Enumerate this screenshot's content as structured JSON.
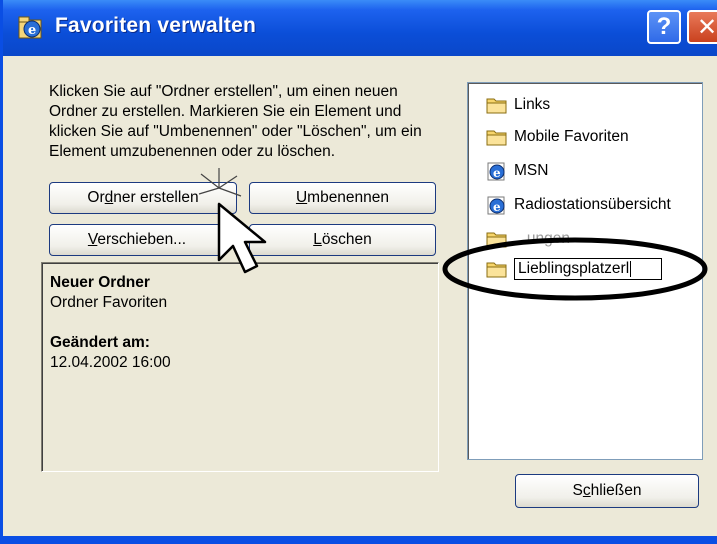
{
  "window": {
    "title": "Favoriten verwalten",
    "help_label": "?",
    "close_label": "✕"
  },
  "instructions": "Klicken Sie auf \"Ordner erstellen\", um einen neuen Ordner zu erstellen. Markieren Sie ein Element und klicken Sie auf \"Umbenennen\" oder \"Löschen\", um ein Element umzubenennen oder zu löschen.",
  "buttons": {
    "new_folder": {
      "pre": "Or",
      "key": "d",
      "post": "ner erstellen"
    },
    "rename": {
      "pre": "",
      "key": "U",
      "post": "mbenennen"
    },
    "move": {
      "pre": "",
      "key": "V",
      "post": "erschieben..."
    },
    "delete": {
      "pre": "",
      "key": "L",
      "post": "öschen"
    },
    "close": {
      "pre": "S",
      "key": "c",
      "post": "hließen"
    }
  },
  "details": {
    "name": "Neuer Ordner",
    "type": "Ordner Favoriten",
    "modified_label": "Geändert am:",
    "modified_value": "12.04.2002 16:00"
  },
  "tree": {
    "items": [
      {
        "label": "Links",
        "icon": "folder-icon"
      },
      {
        "label": "Mobile Favoriten",
        "icon": "folder-icon"
      },
      {
        "label": "MSN",
        "icon": "ie-icon"
      },
      {
        "label": "Radiostationsübersicht",
        "icon": "ie-icon"
      },
      {
        "label": "...ungen",
        "icon": "folder-icon"
      }
    ],
    "edit_value": "Lieblingsplatzerl"
  },
  "colors": {
    "titlebar": "#0b4ed8",
    "window_bg": "#ece9d8",
    "highlight_oval": "#000000"
  }
}
